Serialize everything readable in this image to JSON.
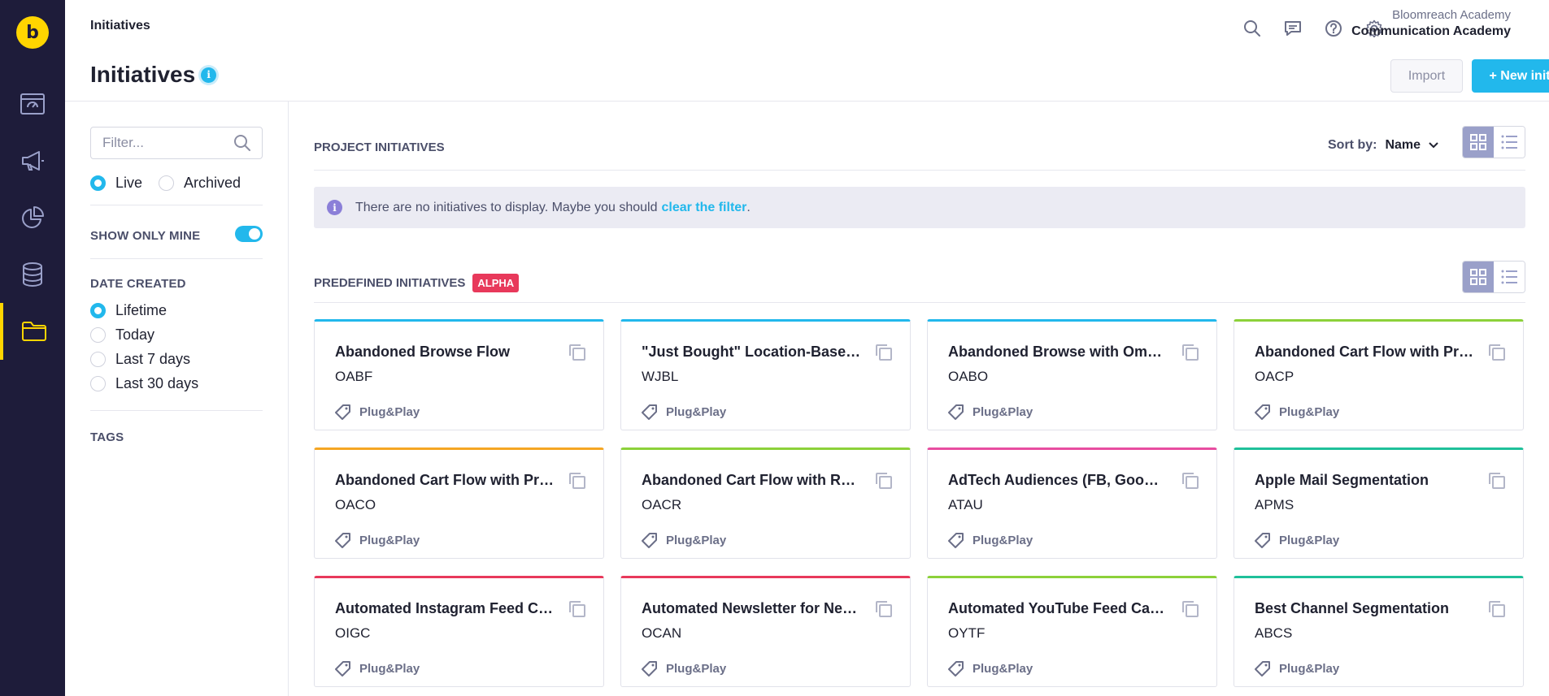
{
  "header": {
    "breadcrumb": "Initiatives",
    "title": "Initiatives",
    "info_glyph": "i",
    "account_org": "Bloomreach Academy",
    "account_project": "Communication Academy",
    "import_label": "Import",
    "new_label": "+ New initiative"
  },
  "nav": {
    "logo_glyph": "b",
    "items": [
      "dashboard-icon",
      "megaphone-icon",
      "analytics-pie-icon",
      "database-icon",
      "folder-icon"
    ],
    "active": "folder-icon"
  },
  "filters": {
    "placeholder": "Filter...",
    "status_live": "Live",
    "status_archived": "Archived",
    "show_only_mine": "SHOW ONLY MINE",
    "date_created": "DATE CREATED",
    "date_options": [
      "Lifetime",
      "Today",
      "Last 7 days",
      "Last 30 days"
    ],
    "tags": "TAGS"
  },
  "project": {
    "section_title": "PROJECT INITIATIVES",
    "sort_label": "Sort by:",
    "sort_value": "Name",
    "notice_text": "There are no initiatives to display. Maybe you should",
    "notice_link": "clear the filter",
    "notice_end": "."
  },
  "predefined": {
    "section_title": "PREDEFINED INITIATIVES",
    "badge": "ALPHA",
    "cards": [
      {
        "title": "Abandoned Browse Flow",
        "code": "OABF",
        "tag": "Plug&Play",
        "color": "#22b8ec"
      },
      {
        "title": "\"Just Bought\" Location-Based Recommendations",
        "code": "WJBL",
        "tag": "Plug&Play",
        "color": "#22b8ec"
      },
      {
        "title": "Abandoned Browse with Omnichannel",
        "code": "OABO",
        "tag": "Plug&Play",
        "color": "#22b8ec"
      },
      {
        "title": "Abandoned Cart Flow with Product Recommendations",
        "code": "OACP",
        "tag": "Plug&Play",
        "color": "#8cd13a"
      },
      {
        "title": "Abandoned Cart Flow with Product Offer",
        "code": "OACO",
        "tag": "Plug&Play",
        "color": "#f5a623"
      },
      {
        "title": "Abandoned Cart Flow with Reminders",
        "code": "OACR",
        "tag": "Plug&Play",
        "color": "#8cd13a"
      },
      {
        "title": "AdTech Audiences (FB, Google)",
        "code": "ATAU",
        "tag": "Plug&Play",
        "color": "#e84da0"
      },
      {
        "title": "Apple Mail Segmentation",
        "code": "APMS",
        "tag": "Plug&Play",
        "color": "#1fc09a"
      },
      {
        "title": "Automated Instagram Feed Campaign",
        "code": "OIGC",
        "tag": "Plug&Play",
        "color": "#e8395b"
      },
      {
        "title": "Automated Newsletter for New Products",
        "code": "OCAN",
        "tag": "Plug&Play",
        "color": "#e8395b"
      },
      {
        "title": "Automated YouTube Feed Campaign",
        "code": "OYTF",
        "tag": "Plug&Play",
        "color": "#8cd13a"
      },
      {
        "title": "Best Channel Segmentation",
        "code": "ABCS",
        "tag": "Plug&Play",
        "color": "#1fc09a"
      }
    ]
  }
}
